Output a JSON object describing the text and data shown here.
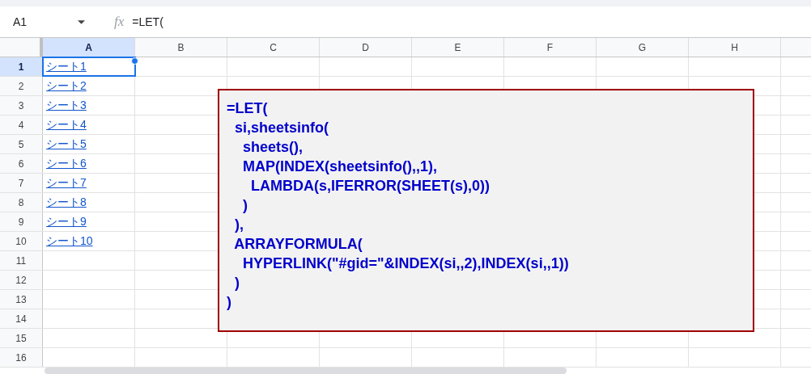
{
  "formula_bar": {
    "name_box": "A1",
    "fx": "fx",
    "formula": "=LET("
  },
  "columns": [
    {
      "label": "A",
      "selected": true
    },
    {
      "label": "B",
      "selected": false
    },
    {
      "label": "C",
      "selected": false
    },
    {
      "label": "D",
      "selected": false
    },
    {
      "label": "E",
      "selected": false
    },
    {
      "label": "F",
      "selected": false
    },
    {
      "label": "G",
      "selected": false
    },
    {
      "label": "H",
      "selected": false
    }
  ],
  "rows": [
    {
      "label": "1",
      "selected": true,
      "cell_a": "シート1"
    },
    {
      "label": "2",
      "selected": false,
      "cell_a": "シート2"
    },
    {
      "label": "3",
      "selected": false,
      "cell_a": "シート3"
    },
    {
      "label": "4",
      "selected": false,
      "cell_a": "シート4"
    },
    {
      "label": "5",
      "selected": false,
      "cell_a": "シート5"
    },
    {
      "label": "6",
      "selected": false,
      "cell_a": "シート6"
    },
    {
      "label": "7",
      "selected": false,
      "cell_a": "シート7"
    },
    {
      "label": "8",
      "selected": false,
      "cell_a": "シート8"
    },
    {
      "label": "9",
      "selected": false,
      "cell_a": "シート9"
    },
    {
      "label": "10",
      "selected": false,
      "cell_a": "シート10"
    },
    {
      "label": "11",
      "selected": false
    },
    {
      "label": "12",
      "selected": false
    },
    {
      "label": "13",
      "selected": false
    },
    {
      "label": "14",
      "selected": false
    },
    {
      "label": "15",
      "selected": false
    },
    {
      "label": "16",
      "selected": false
    }
  ],
  "text_box": {
    "lines": [
      "=LET(",
      "  si,sheetsinfo(",
      "    sheets(),",
      "    MAP(INDEX(sheetsinfo(),,1),",
      "      LAMBDA(s,IFERROR(SHEET(s),0))",
      "    )",
      "  ),",
      "  ARRAYFORMULA(",
      "    HYPERLINK(\"#gid=\"&INDEX(si,,2),INDEX(si,,1))",
      "  )",
      ")"
    ]
  }
}
